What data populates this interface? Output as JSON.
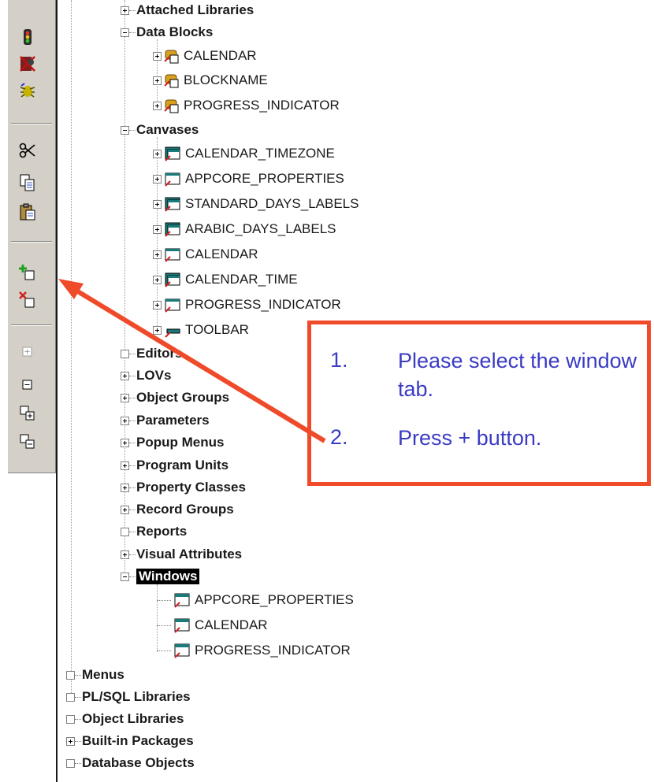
{
  "toolbar": {
    "buttons": [
      {
        "name": "run-form-icon"
      },
      {
        "name": "debug-icon"
      },
      {
        "name": "run-debug-icon"
      },
      {
        "name": "cut-icon"
      },
      {
        "name": "copy-icon"
      },
      {
        "name": "paste-icon"
      },
      {
        "name": "create-icon"
      },
      {
        "name": "delete-icon"
      },
      {
        "name": "expand-icon"
      },
      {
        "name": "collapse-icon"
      },
      {
        "name": "expand-all-icon"
      },
      {
        "name": "collapse-all-icon"
      }
    ]
  },
  "tree": {
    "attached_libraries": "Attached Libraries",
    "data_blocks": {
      "label": "Data Blocks",
      "items": [
        "CALENDAR",
        "BLOCKNAME",
        "PROGRESS_INDICATOR"
      ]
    },
    "canvases": {
      "label": "Canvases",
      "items": [
        "CALENDAR_TIMEZONE",
        "APPCORE_PROPERTIES",
        "STANDARD_DAYS_LABELS",
        "ARABIC_DAYS_LABELS",
        "CALENDAR",
        "CALENDAR_TIME",
        "PROGRESS_INDICATOR",
        "TOOLBAR"
      ]
    },
    "categories": [
      "Editors",
      "LOVs",
      "Object Groups",
      "Parameters",
      "Popup Menus",
      "Program Units",
      "Property Classes",
      "Record Groups",
      "Reports",
      "Visual Attributes"
    ],
    "windows": {
      "label": "Windows",
      "items": [
        "APPCORE_PROPERTIES",
        "CALENDAR",
        "PROGRESS_INDICATOR"
      ]
    },
    "top_level": [
      "Menus",
      "PL/SQL Libraries",
      "Object Libraries",
      "Built-in Packages",
      "Database Objects"
    ]
  },
  "callout": {
    "steps": [
      {
        "number": "1.",
        "text": "Please select the window tab."
      },
      {
        "number": "2.",
        "text": "Press + button."
      }
    ],
    "accent_color": "#ef4b2b",
    "text_color": "#3b3bc4"
  }
}
